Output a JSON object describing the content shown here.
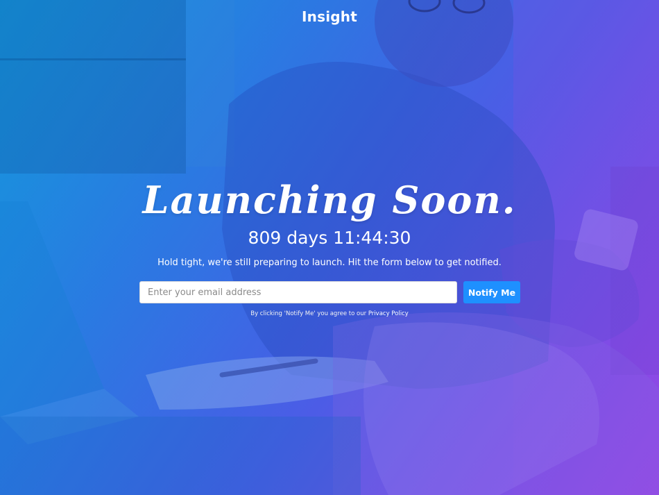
{
  "header": {
    "brand": "Insight"
  },
  "hero": {
    "headline": "Launching Soon.",
    "countdown": "809 days 11:44:30",
    "subtext": "Hold tight, we're still preparing to launch. Hit the form below to get notified."
  },
  "signup": {
    "email_placeholder": "Enter your email address",
    "email_value": "",
    "button_label": "Notify Me"
  },
  "legal": {
    "prefix": "By clicking 'Notify Me' you agree to our",
    "link_label": "Privacy Policy"
  },
  "colors": {
    "gradient_start": "#1e9ad6",
    "gradient_end": "#9b45e6",
    "button": "#1e90ff",
    "text": "#ffffff"
  }
}
